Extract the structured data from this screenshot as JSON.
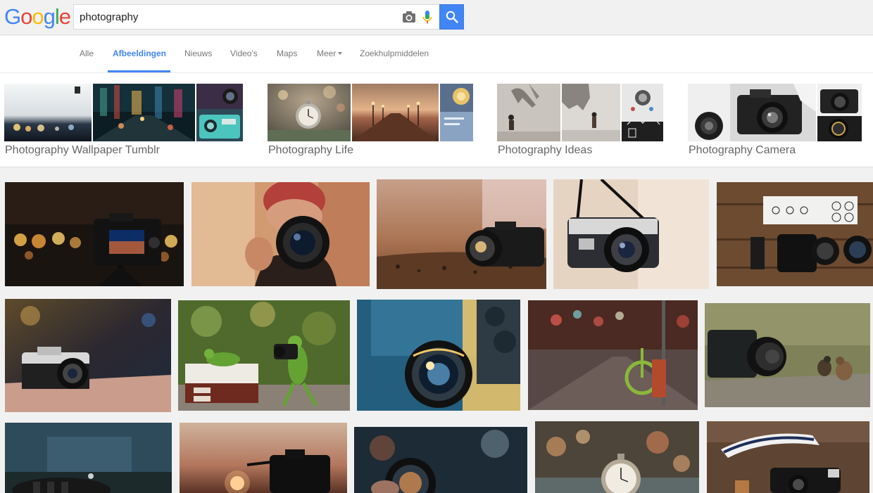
{
  "logo": {
    "letters": [
      "G",
      "o",
      "o",
      "g",
      "l",
      "e"
    ],
    "colors": [
      "#4285f4",
      "#ea4335",
      "#fbbc05",
      "#4285f4",
      "#34a853",
      "#ea4335"
    ]
  },
  "search": {
    "query": "photography",
    "camera_icon": "camera-icon",
    "mic_icon": "microphone-icon",
    "button_icon": "search-icon",
    "accent": "#4285f4"
  },
  "tabs": {
    "all": "Alle",
    "images": "Afbeeldingen",
    "news": "Nieuws",
    "videos": "Video's",
    "maps": "Maps",
    "more": "Meer",
    "tools": "Zoekhulpmiddelen"
  },
  "related": [
    {
      "label": "Photography Wallpaper Tumblr"
    },
    {
      "label": "Photography Life"
    },
    {
      "label": "Photography Ideas"
    },
    {
      "label": "Photography Camera"
    }
  ]
}
